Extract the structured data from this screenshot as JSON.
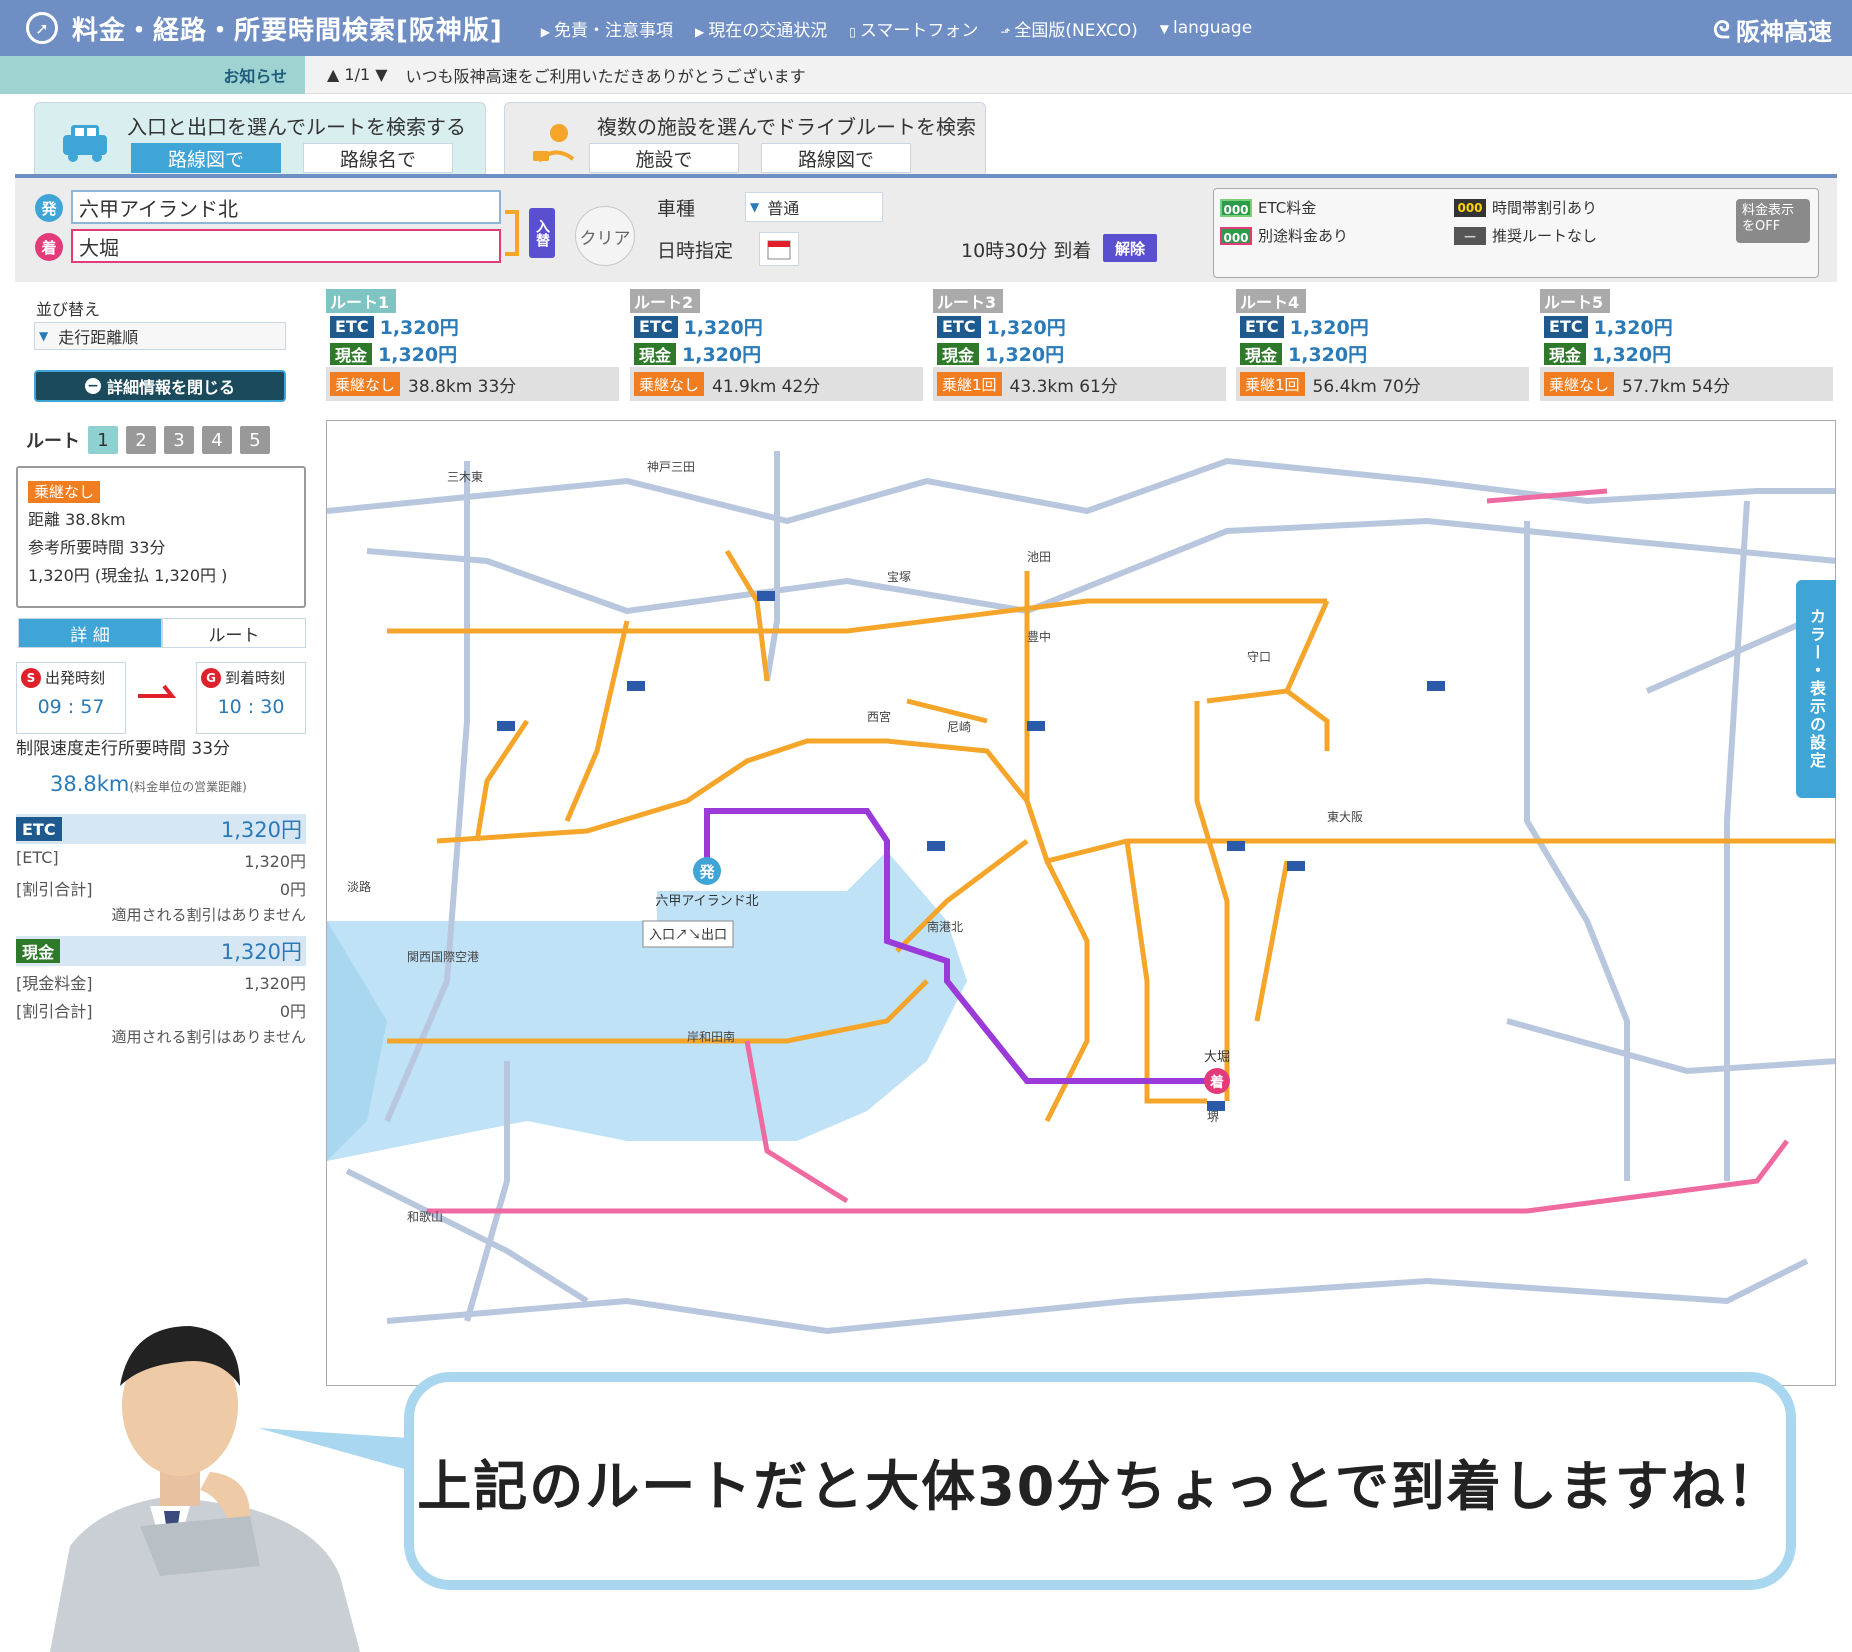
{
  "header": {
    "title": "料金・経路・所要時間検索[阪神版]",
    "nav": [
      "免責・注意事項",
      "現在の交通状況",
      "スマートフォン",
      "全国版(NEXCO)",
      "language"
    ],
    "brand": "阪神高速"
  },
  "notice": {
    "label": "お知らせ",
    "pager": "1/1",
    "message": "いつも阪神高速をご利用いただきありがとうございます"
  },
  "modes": {
    "entry_exit": {
      "title": "入口と出口を選んでルートを検索する",
      "tabs": [
        "路線図で",
        "路線名で"
      ]
    },
    "drive": {
      "title": "複数の施設を選んでドライブルートを検索",
      "tabs": [
        "施設で",
        "路線図で"
      ]
    }
  },
  "search": {
    "origin_badge": "発",
    "origin": "六甲アイランド北",
    "dest_badge": "着",
    "destination": "大堀",
    "swap_label": "入替",
    "clear_label": "クリア",
    "vehicle_label": "車種",
    "vehicle_value": "普通",
    "datetime_label": "日時指定",
    "arrival_text": "10時30分 到着",
    "cancel_label": "解除"
  },
  "legend": {
    "badge": "000",
    "etc_fee": "ETC料金",
    "separate_fee": "別途料金あり",
    "time_discount": "時間帯割引あり",
    "no_recommend": "推奨ルートなし",
    "fee_off": "料金表示をOFF"
  },
  "sidebar": {
    "sort_label": "並び替え",
    "sort_value": "走行距離順",
    "close_detail": "詳細情報を閉じる",
    "route_label": "ルート",
    "route_numbers": [
      "1",
      "2",
      "3",
      "4",
      "5"
    ],
    "summary": {
      "tag": "乗継なし",
      "distance": "距離 38.8km",
      "time": "参考所要時間 33分",
      "fee": "1,320円 (現金払 1,320円 )"
    },
    "detail_tabs": [
      "詳 細",
      "ルート"
    ],
    "depart": {
      "badge": "S",
      "label": "出発時刻",
      "value": "09 : 57"
    },
    "arrive": {
      "badge": "G",
      "label": "到着時刻",
      "value": "10 : 30"
    },
    "limit_time": "制限速度走行所要時間 33分",
    "distance_big": "38.8km",
    "distance_note": "(料金単位の営業距離)",
    "etc": {
      "badge": "ETC",
      "total": "1,320円",
      "row1_label": "[ETC]",
      "row1_value": "1,320円",
      "row2_label": "[割引合計]",
      "row2_value": "0円",
      "note": "適用される割引はありません"
    },
    "cash": {
      "badge": "現金",
      "total": "1,320円",
      "row1_label": "[現金料金]",
      "row1_value": "1,320円",
      "row2_label": "[割引合計]",
      "row2_value": "0円",
      "note": "適用される割引はありません"
    }
  },
  "routes": [
    {
      "name": "ルート1",
      "etc": "1,320円",
      "cash": "1,320円",
      "tag": "乗継なし",
      "info": "38.8km 33分"
    },
    {
      "name": "ルート2",
      "etc": "1,320円",
      "cash": "1,320円",
      "tag": "乗継なし",
      "info": "41.9km 42分"
    },
    {
      "name": "ルート3",
      "etc": "1,320円",
      "cash": "1,320円",
      "tag": "乗継1回",
      "info": "43.3km 61分"
    },
    {
      "name": "ルート4",
      "etc": "1,320円",
      "cash": "1,320円",
      "tag": "乗継1回",
      "info": "56.4km 70分"
    },
    {
      "name": "ルート5",
      "etc": "1,320円",
      "cash": "1,320円",
      "tag": "乗継なし",
      "info": "57.7km 54分"
    }
  ],
  "route_badges": {
    "etc": "ETC",
    "cash": "現金"
  },
  "map": {
    "labels": {
      "start": "六甲アイランド北",
      "goal": "大堀",
      "legend": "入口↗↘出口",
      "kobe": "神戸三田",
      "sanda": "三木東",
      "nishinomiya": "西宮",
      "amagasaki": "尼崎",
      "osaka_port": "南港北",
      "sakai": "堺",
      "kishiwada": "岸和田南",
      "kansai_airport": "関西国際空港",
      "higashiosaka": "東大阪",
      "moriguchi": "守口",
      "toyonaka": "豊中",
      "ikeda": "池田",
      "takarazuka": "宝塚",
      "awaji": "淡路",
      "wakayama": "和歌山"
    }
  },
  "color_tab": "カラー・表示の設定",
  "bubble": {
    "text": "上記のルートだと大体30分ちょっとで到着しますね！"
  }
}
